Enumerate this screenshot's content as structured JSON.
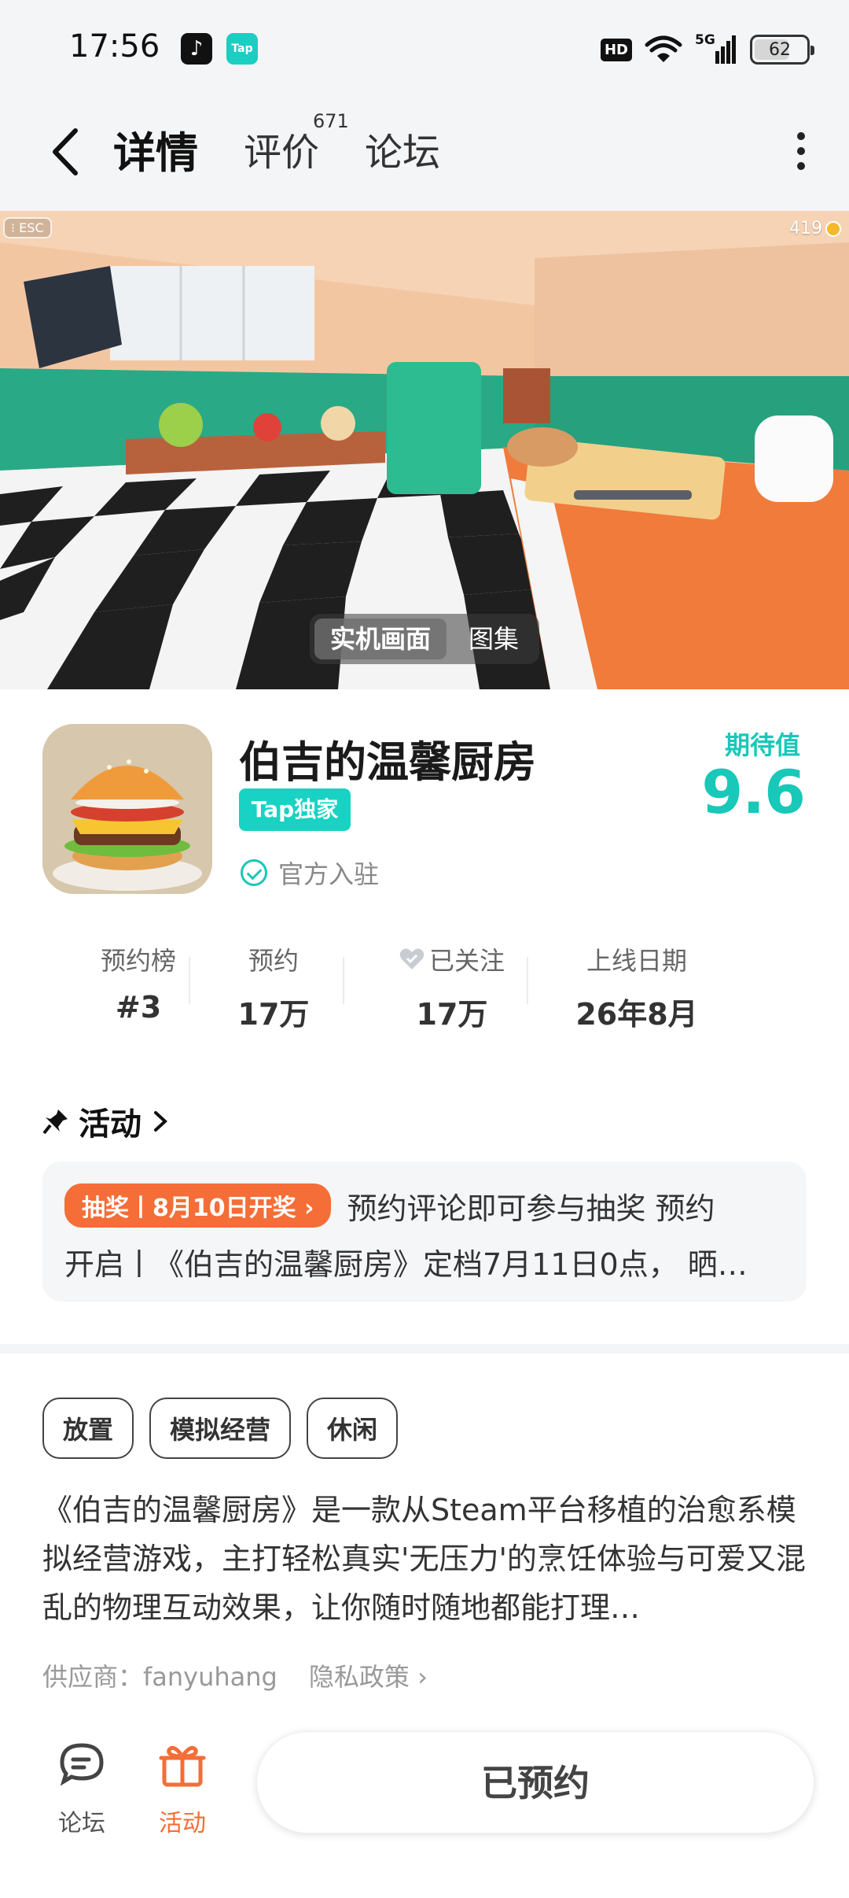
{
  "status_bar": {
    "time": "17:56",
    "hd": "HD",
    "network": "5G",
    "battery": "62"
  },
  "nav": {
    "tabs": [
      {
        "label": "详情"
      },
      {
        "label": "评价"
      },
      {
        "label": "论坛"
      }
    ],
    "review_count": "671"
  },
  "hero": {
    "esc_label": "ESC",
    "score": "419",
    "tabs": [
      {
        "label": "实机画面"
      },
      {
        "label": "图集"
      }
    ]
  },
  "game": {
    "title": "伯吉的温馨厨房",
    "badge": "Tap独家",
    "official": "官方入驻",
    "expect_label": "期待值",
    "expect_value": "9.6"
  },
  "stats": [
    {
      "label": "预约榜",
      "value": "#3"
    },
    {
      "label": "预约",
      "value": "17万"
    },
    {
      "label": "已关注",
      "value": "17万"
    },
    {
      "label": "上线日期",
      "value": "26年8月"
    }
  ],
  "activity": {
    "title": "活动",
    "pill": "抽奖丨8月10日开奖",
    "line1": "预约评论即可参与抽奖 预约",
    "line2": "开启丨《伯吉的温馨厨房》定档7月11日0点， 晒…"
  },
  "tags": [
    "放置",
    "模拟经营",
    "休闲"
  ],
  "description": "《伯吉的温馨厨房》是一款从Steam平台移植的治愈系模拟经营游戏，主打轻松真实'无压力'的烹饪体验与可爱又混乱的物理互动效果，让你随时随地都能打理…",
  "provider": {
    "label": "供应商：fanyuhang",
    "privacy": "隐私政策"
  },
  "bottom": {
    "forum": "论坛",
    "activity": "活动",
    "reserve": "已预约"
  },
  "colors": {
    "accent": "#18d3c3",
    "orange": "#f56d37"
  }
}
